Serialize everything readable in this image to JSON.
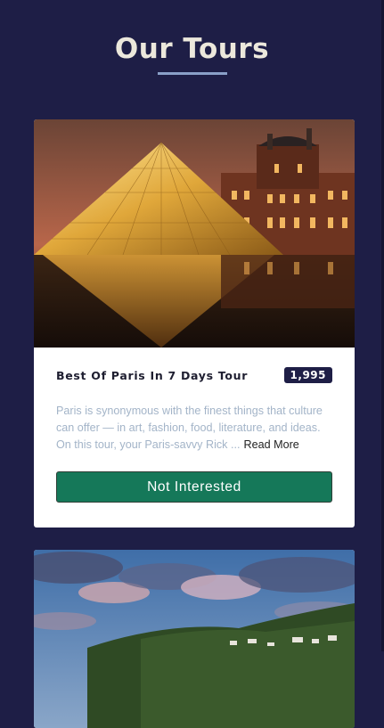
{
  "page": {
    "title": "Our Tours"
  },
  "tours": [
    {
      "name": "Best Of Paris In 7 Days Tour",
      "price": "1,995",
      "description": "Paris is synonymous with the finest things that culture can offer — in art, fashion, food, literature, and ideas. On this tour, your Paris-savvy Rick ...",
      "read_more_label": "Read More",
      "button_label": "Not Interested",
      "image_icon": "louvre-pyramid-photo"
    },
    {
      "image_icon": "mountain-landscape-photo"
    }
  ],
  "colors": {
    "background": "#1e1e46",
    "accent": "#157859",
    "price_badge": "#1e1e46",
    "description_text": "#a3b4c8"
  }
}
